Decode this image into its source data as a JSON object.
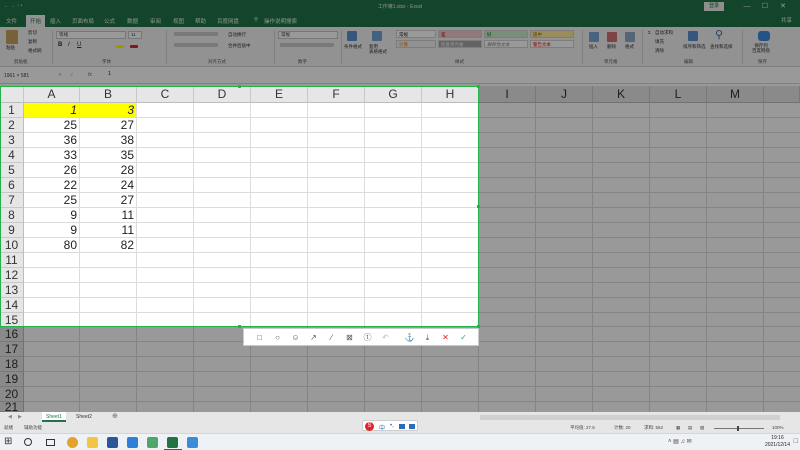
{
  "window": {
    "quick_access": "← → ↑ •",
    "title": "工作簿1.xlsx  -  Excel",
    "login": "登录",
    "min": "—",
    "max": "☐",
    "close": "✕"
  },
  "menu": {
    "tabs": [
      "文件",
      "开始",
      "插入",
      "页面布局",
      "公式",
      "数据",
      "审阅",
      "视图",
      "帮助",
      "百度网盘"
    ],
    "search": "操作说明搜索",
    "share": "共享"
  },
  "ribbon": {
    "paste": "粘贴",
    "cut": "剪切",
    "copy": "复制",
    "format_painter": "格式刷",
    "clipboard": "剪贴板",
    "font_name": "等线",
    "font_size": "11",
    "font": "字体",
    "wrap": "自动换行",
    "merge": "合并后居中",
    "alignment": "对齐方式",
    "number_format": "常规",
    "number": "数字",
    "cond_format": "条件格式",
    "table_format": "套用\n表格格式",
    "styles": "样式",
    "style_normal": "常规",
    "style_bad": "差",
    "style_good": "好",
    "style_neutral": "适中",
    "style_calc": "计算",
    "style_check": "检查单元格",
    "style_explain": "解释性文本",
    "style_warn": "警告文本",
    "insert": "插入",
    "delete": "删除",
    "format": "格式",
    "cells": "单元格",
    "autosum": "自动求和",
    "fill": "填充",
    "clear": "清除",
    "sort_filter": "排序和筛选",
    "find_select": "查找和选择",
    "editing": "编辑",
    "save_baidu": "保存到\n百度网盘",
    "save": "保存"
  },
  "formula_bar": {
    "name_box": "1961 × 581",
    "fx": "fx",
    "value": "1"
  },
  "grid": {
    "columns": [
      "A",
      "B",
      "C",
      "D",
      "E",
      "F",
      "G",
      "H",
      "I",
      "J",
      "K",
      "L",
      "M"
    ],
    "rows_top": [
      "1",
      "2",
      "3",
      "4",
      "5",
      "6",
      "7",
      "8",
      "9",
      "10",
      "11",
      "12",
      "13",
      "14",
      "15"
    ],
    "rows_bottom": [
      "16",
      "17",
      "18",
      "19",
      "20",
      "21"
    ],
    "row1": {
      "A": "1",
      "B": "3"
    },
    "data": [
      {
        "A": "25",
        "B": "27"
      },
      {
        "A": "36",
        "B": "38"
      },
      {
        "A": "33",
        "B": "35"
      },
      {
        "A": "26",
        "B": "28"
      },
      {
        "A": "22",
        "B": "24"
      },
      {
        "A": "25",
        "B": "27"
      },
      {
        "A": "9",
        "B": "11"
      },
      {
        "A": "9",
        "B": "11"
      },
      {
        "A": "80",
        "B": "82"
      }
    ],
    "highlight_color": "#ffff00"
  },
  "snap_toolbar": {
    "tools": [
      "rect-icon",
      "ellipse-icon",
      "emoji-icon",
      "arrow-icon",
      "pen-icon",
      "mosaic-icon",
      "text-icon",
      "undo-icon",
      "pin-icon",
      "download-icon",
      "close-icon",
      "confirm-icon"
    ],
    "glyphs": [
      "□",
      "○",
      "☺",
      "↗",
      "∕",
      "⊠",
      "ⓣ",
      "↶",
      "⚓",
      "⤓",
      "✕",
      "✓"
    ]
  },
  "sheets": {
    "tabs": [
      "Sheet1",
      "Sheet2"
    ],
    "add": "⊕"
  },
  "status": {
    "ready": "就绪",
    "mode": "辅助功能",
    "average": "平均值: 27.6",
    "count": "计数: 20",
    "sum": "求和: 552",
    "zoom": "100%"
  },
  "taskbar": {
    "time": "19:16",
    "date": "2021/12/14",
    "ime": "中"
  }
}
